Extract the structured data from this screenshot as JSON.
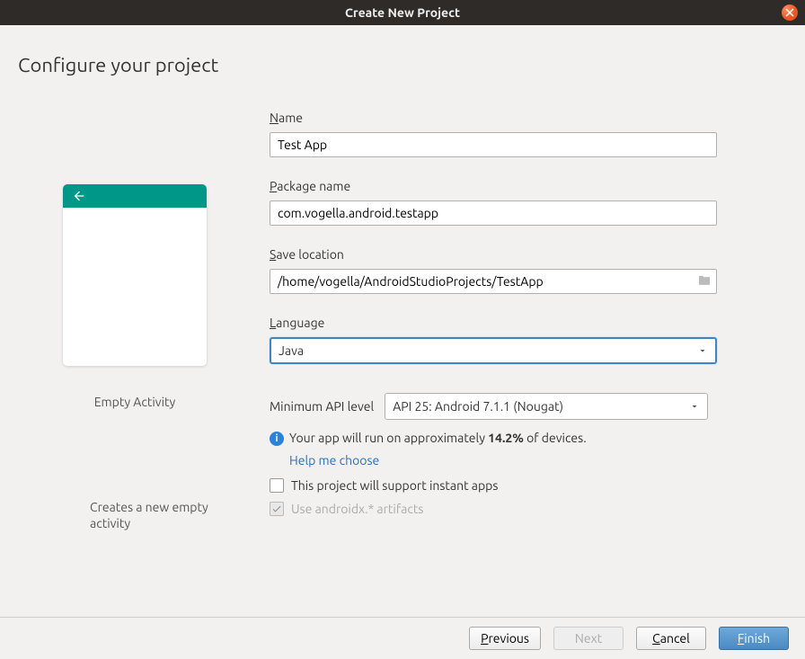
{
  "window": {
    "title": "Create New Project"
  },
  "heading": "Configure your project",
  "template": {
    "name": "Empty Activity",
    "description": "Creates a new empty activity"
  },
  "fields": {
    "name": {
      "label_prefix": "N",
      "label_rest": "ame",
      "value": "Test App"
    },
    "package": {
      "label_prefix": "P",
      "label_rest": "ackage name",
      "value": "com.vogella.android.testapp"
    },
    "save": {
      "label_prefix": "S",
      "label_rest": "ave location",
      "value": "/home/vogella/AndroidStudioProjects/TestApp"
    },
    "language": {
      "label_prefix": "L",
      "label_rest": "anguage",
      "value": "Java"
    },
    "api": {
      "label": "Minimum API level",
      "value": "API 25: Android 7.1.1 (Nougat)"
    }
  },
  "info": {
    "prefix": "Your app will run on approximately ",
    "pct": "14.2%",
    "suffix": " of devices.",
    "help": "Help me choose"
  },
  "checks": {
    "instant": "This project will support instant apps",
    "androidx": "Use androidx.* artifacts"
  },
  "buttons": {
    "previous_prefix": "P",
    "previous_rest": "revious",
    "next": "Next",
    "cancel_prefix": "C",
    "cancel_rest": "ancel",
    "finish_prefix": "F",
    "finish_rest": "inish"
  }
}
